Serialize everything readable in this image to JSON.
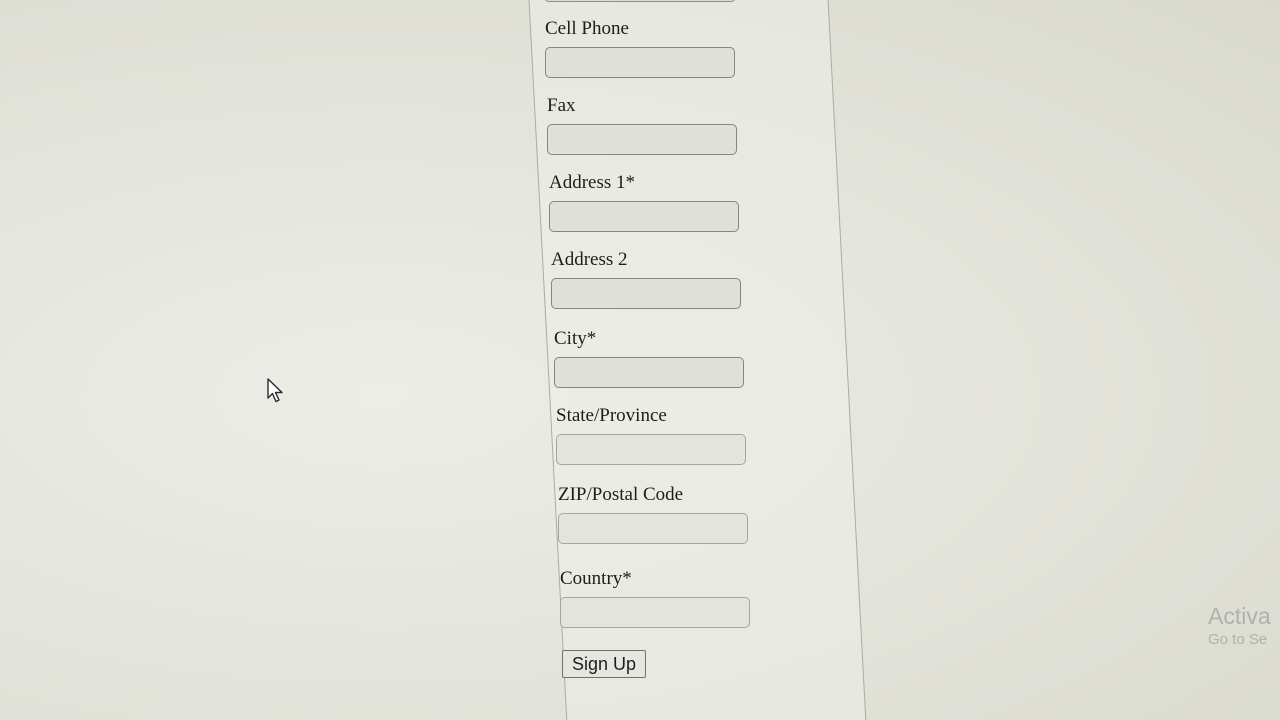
{
  "form": {
    "fields": [
      {
        "label": "Cell Phone",
        "value": ""
      },
      {
        "label": "Fax",
        "value": ""
      },
      {
        "label": "Address 1*",
        "value": ""
      },
      {
        "label": "Address 2",
        "value": ""
      },
      {
        "label": "City*",
        "value": ""
      },
      {
        "label": "State/Province",
        "value": ""
      },
      {
        "label": "ZIP/Postal Code",
        "value": ""
      },
      {
        "label": "Country*",
        "value": ""
      }
    ],
    "submit_label": "Sign Up"
  },
  "watermark": {
    "title": "Activa",
    "subtitle": "Go to Se"
  },
  "icons": {
    "cursor": "mouse-pointer-icon"
  }
}
